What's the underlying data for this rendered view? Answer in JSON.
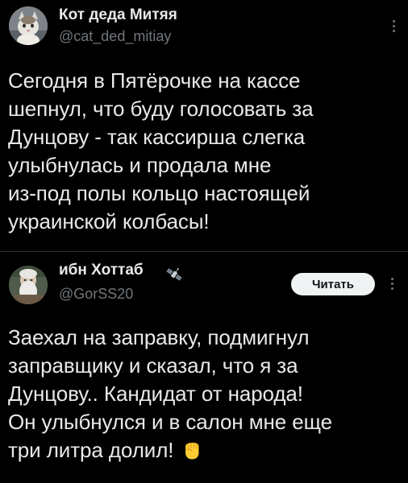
{
  "tweets": [
    {
      "author_name": "Кот деда Митяя",
      "author_handle": "@cat_ded_mitiay",
      "text": "Сегодня в Пятёрочке на кассе\nшепнул, что буду голосовать за\nДунцову - так кассирша слегка\nулыбнулась и продала мне\nиз-под полы кольцо настоящей\nукраинской колбасы!",
      "avatar_icon": "cat-photo-avatar",
      "more_icon": "more-vertical-icon"
    },
    {
      "author_name": "ибн Хоттаб",
      "author_handle": "@GorSS20",
      "follow_label": "Читать",
      "badge_icon": "satellite-icon",
      "text": "Заехал на заправку, подмигнул\nзаправщику и сказал, что я за\nДунцову.. Кандидат от народа!\nОн улыбнулся и в салон мне еще\nтри литра долил!",
      "text_emoji": "raised-fist-emoji",
      "avatar_icon": "old-man-photo-avatar",
      "more_icon": "more-vertical-icon"
    }
  ],
  "colors": {
    "background": "#000000",
    "text": "#e7e9ea",
    "secondary": "#71767b",
    "divider": "#2f3336",
    "button_bg": "#eff3f4",
    "button_text": "#0f1419"
  }
}
